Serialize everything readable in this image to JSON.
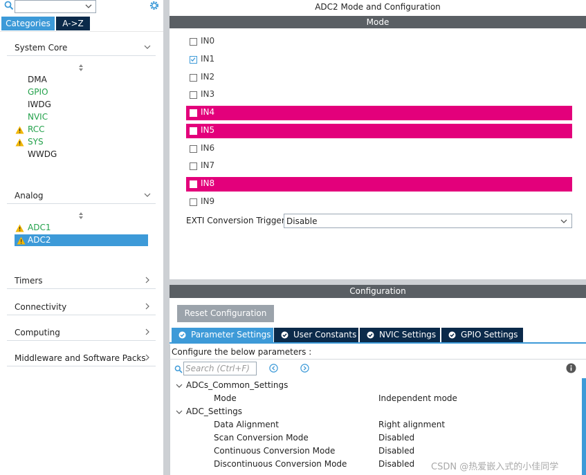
{
  "left": {
    "search": {
      "value": ""
    },
    "tabs": {
      "categories": "Categories",
      "az": "A->Z"
    },
    "categories": [
      {
        "label": "System Core",
        "expanded": true,
        "items": [
          {
            "label": "DMA",
            "color": "#222222",
            "warning": false
          },
          {
            "label": "GPIO",
            "color": "#22a14a",
            "warning": false
          },
          {
            "label": "IWDG",
            "color": "#222222",
            "warning": false
          },
          {
            "label": "NVIC",
            "color": "#22a14a",
            "warning": false
          },
          {
            "label": "RCC",
            "color": "#22a14a",
            "warning": true
          },
          {
            "label": "SYS",
            "color": "#22a14a",
            "warning": true
          },
          {
            "label": "WWDG",
            "color": "#222222",
            "warning": false
          }
        ]
      },
      {
        "label": "Analog",
        "expanded": true,
        "items": [
          {
            "label": "ADC1",
            "color": "#22a14a",
            "warning": true,
            "selected": false
          },
          {
            "label": "ADC2",
            "color": "#ffffff",
            "warning": true,
            "selected": true
          }
        ]
      },
      {
        "label": "Timers",
        "expanded": false
      },
      {
        "label": "Connectivity",
        "expanded": false
      },
      {
        "label": "Computing",
        "expanded": false
      },
      {
        "label": "Middleware and Software Packs",
        "expanded": false
      }
    ]
  },
  "right": {
    "title": "ADC2 Mode and Configuration",
    "mode_bar": "Mode",
    "channels": [
      {
        "label": "IN0",
        "checked": false,
        "highlight": false
      },
      {
        "label": "IN1",
        "checked": true,
        "highlight": false
      },
      {
        "label": "IN2",
        "checked": false,
        "highlight": false
      },
      {
        "label": "IN3",
        "checked": false,
        "highlight": false
      },
      {
        "label": "IN4",
        "checked": false,
        "highlight": true
      },
      {
        "label": "IN5",
        "checked": false,
        "highlight": true
      },
      {
        "label": "IN6",
        "checked": false,
        "highlight": false
      },
      {
        "label": "IN7",
        "checked": false,
        "highlight": false
      },
      {
        "label": "IN8",
        "checked": false,
        "highlight": true
      },
      {
        "label": "IN9",
        "checked": false,
        "highlight": false
      }
    ],
    "exti": {
      "label": "EXTI Conversion Trigger",
      "value": "Disable"
    },
    "config_bar": "Configuration",
    "reset_button": "Reset Configuration",
    "config_tabs": [
      {
        "label": "Parameter Settings",
        "active": true
      },
      {
        "label": "User Constants",
        "active": false
      },
      {
        "label": "NVIC Settings",
        "active": false
      },
      {
        "label": "GPIO Settings",
        "active": false
      }
    ],
    "config_caption": "Configure the below parameters :",
    "config_search_placeholder": "Search (Ctrl+F)",
    "tree": [
      {
        "label": "ADCs_Common_Settings",
        "type": "group"
      },
      {
        "label": "Mode",
        "value": "Independent mode",
        "type": "param"
      },
      {
        "label": "ADC_Settings",
        "type": "group"
      },
      {
        "label": "Data Alignment",
        "value": "Right alignment",
        "type": "param"
      },
      {
        "label": "Scan Conversion Mode",
        "value": "Disabled",
        "type": "param"
      },
      {
        "label": "Continuous Conversion Mode",
        "value": "Disabled",
        "type": "param"
      },
      {
        "label": "Discontinuous Conversion Mode",
        "value": "Disabled",
        "type": "param"
      }
    ]
  },
  "watermark": "CSDN @热爱嵌入式的小佳同学",
  "colors": {
    "accent": "#3d9ad8",
    "dark_tab": "#0b2a4a",
    "highlight_pink": "#e3007b",
    "status_green": "#22a14a",
    "warning_yellow": "#f2b705",
    "bar_gray": "#5a5f64"
  }
}
